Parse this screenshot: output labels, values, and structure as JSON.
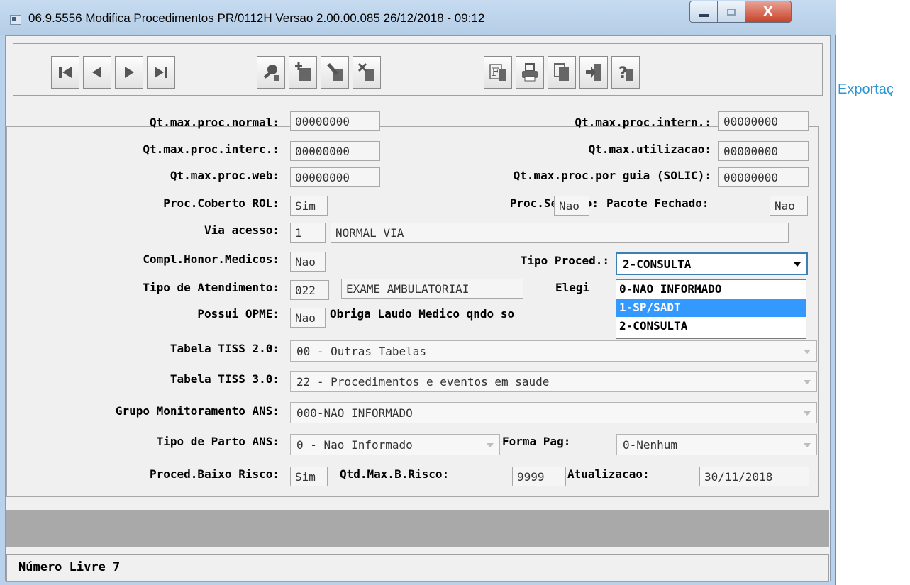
{
  "window": {
    "title": "06.9.5556  Modifica  Procedimentos PR/0112H Versao 2.00.00.085 26/12/2018 - 09:12",
    "close_glyph": "X"
  },
  "toolbar": {
    "buttons": [
      {
        "name": "first-record",
        "icon": "first-icon"
      },
      {
        "name": "prev-record",
        "icon": "prev-icon"
      },
      {
        "name": "next-record",
        "icon": "next-icon"
      },
      {
        "name": "last-record",
        "icon": "last-icon"
      },
      {
        "name": "search",
        "icon": "search-icon"
      },
      {
        "name": "add",
        "icon": "add-icon"
      },
      {
        "name": "edit",
        "icon": "edit-icon"
      },
      {
        "name": "delete",
        "icon": "delete-icon"
      },
      {
        "name": "filter",
        "icon": "filter-icon"
      },
      {
        "name": "print",
        "icon": "print-icon"
      },
      {
        "name": "copy",
        "icon": "copy-icon"
      },
      {
        "name": "exit",
        "icon": "exit-icon"
      },
      {
        "name": "help",
        "icon": "help-icon"
      }
    ]
  },
  "side_link": "Exportaç",
  "form": {
    "qt_max_proc_normal": {
      "label": "Qt.max.proc.normal:",
      "value": "00000000"
    },
    "qt_max_proc_intern": {
      "label": "Qt.max.proc.intern.:",
      "value": "00000000"
    },
    "qt_max_proc_interc": {
      "label": "Qt.max.proc.interc.:",
      "value": "00000000"
    },
    "qt_max_utilizacao": {
      "label": "Qt.max.utilizacao:",
      "value": "00000000"
    },
    "qt_max_proc_web": {
      "label": "Qt.max.proc.web:",
      "value": "00000000"
    },
    "qt_max_proc_por_guia": {
      "label": "Qt.max.proc.por guia (SOLIC):",
      "value": "00000000"
    },
    "proc_coberto_rol": {
      "label": "Proc.Coberto ROL:",
      "value": "Sim"
    },
    "proc_seriado": {
      "label": "Proc.Seriado:",
      "value": "Nao"
    },
    "pacote_fechado": {
      "label": "Pacote Fechado:",
      "value": "Nao"
    },
    "via_acesso": {
      "label": "Via acesso:",
      "code": "1",
      "desc": "NORMAL VIA"
    },
    "compl_honor_medicos": {
      "label": "Compl.Honor.Medicos:",
      "value": "Nao"
    },
    "tipo_proced": {
      "label": "Tipo Proced.:",
      "value": "2-CONSULTA",
      "options": [
        "0-NAO INFORMADO",
        "1-SP/SADT",
        "2-CONSULTA"
      ],
      "highlighted_index": 1
    },
    "tipo_atendimento": {
      "label": "Tipo de Atendimento:",
      "code": "022",
      "desc": "EXAME AMBULATORIAI"
    },
    "elegi_label": "Elegi",
    "possui_opme": {
      "label": "Possui OPME:",
      "value": "Nao"
    },
    "obriga_laudo_label": "Obriga Laudo Medico qndo so",
    "tabela_tiss_20": {
      "label": "Tabela TISS 2.0:",
      "value": "00 - Outras Tabelas"
    },
    "tabela_tiss_30": {
      "label": "Tabela TISS 3.0:",
      "value": "22 - Procedimentos e eventos em saude"
    },
    "grupo_monitoramento": {
      "label": "Grupo Monitoramento ANS:",
      "value": "000-NAO INFORMADO"
    },
    "tipo_parto": {
      "label": "Tipo de Parto ANS:",
      "value": "0 - Nao Informado"
    },
    "forma_pag": {
      "label": "Forma Pag:",
      "value": "0-Nenhum"
    },
    "proced_baixo_risco": {
      "label": "Proced.Baixo Risco:",
      "value": "Sim"
    },
    "qtd_max_b_risco": {
      "label": "Qtd.Max.B.Risco:",
      "value": "9999"
    },
    "atualizacao": {
      "label": "Atualizacao:",
      "value": "30/11/2018"
    }
  },
  "status": {
    "text": "Número Livre 7"
  }
}
